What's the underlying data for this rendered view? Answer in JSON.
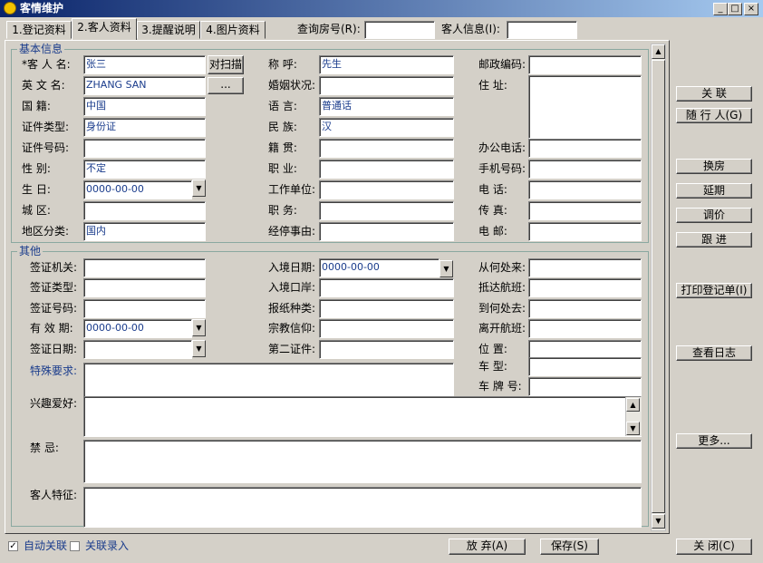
{
  "window": {
    "title": "客情维护",
    "min": "_",
    "max": "□",
    "close": "×"
  },
  "tabs": [
    "1.登记资料",
    "2.客人资料",
    "3.提醒说明",
    "4.图片资料"
  ],
  "search": {
    "room_label": "查询房号(R):",
    "guest_label": "客人信息(I):"
  },
  "basic": {
    "title": "基本信息",
    "rows": [
      {
        "l1": "*客 人 名:",
        "v1": "张三",
        "l2": "称    呼:",
        "v2": "先生",
        "l3": "邮政编码:",
        "v3": ""
      },
      {
        "l1": "英 文 名:",
        "v1": "ZHANG SAN",
        "l2": "婚姻状况:",
        "v2": "",
        "l3": "住    址:",
        "v3": ""
      },
      {
        "l1": "国    籍:",
        "v1": "中国",
        "l2": "语    言:",
        "v2": "普通话"
      },
      {
        "l1": "证件类型:",
        "v1": "身份证",
        "l2": "民    族:",
        "v2": "汉"
      },
      {
        "l1": "证件号码:",
        "v1": "",
        "l2": "籍    贯:",
        "v2": "",
        "l3": "办公电话:",
        "v3": ""
      },
      {
        "l1": "性    别:",
        "v1": "不定",
        "l2": "职    业:",
        "v2": "",
        "l3": "手机号码:",
        "v3": ""
      },
      {
        "l1": "生    日:",
        "v1": "0000-00-00",
        "l2": "工作单位:",
        "v2": "",
        "l3": "电    话:",
        "v3": ""
      },
      {
        "l1": "城    区:",
        "v1": "",
        "l2": "职    务:",
        "v2": "",
        "l3": "传    真:",
        "v3": ""
      },
      {
        "l1": "地区分类:",
        "v1": "国内",
        "l2": "经停事由:",
        "v2": "",
        "l3": "电    邮:",
        "v3": ""
      }
    ],
    "scan_btn": "对扫描",
    "ellipsis_btn": "..."
  },
  "other": {
    "title": "其他",
    "rows": [
      {
        "l1": "签证机关:",
        "v1": "",
        "l2": "入境日期:",
        "v2": "0000-00-00",
        "l3": "从何处来:",
        "v3": ""
      },
      {
        "l1": "签证类型:",
        "v1": "",
        "l2": "入境口岸:",
        "v2": "",
        "l3": "抵达航班:",
        "v3": ""
      },
      {
        "l1": "签证号码:",
        "v1": "",
        "l2": "报纸种类:",
        "v2": "",
        "l3": "到何处去:",
        "v3": ""
      },
      {
        "l1": "有 效 期:",
        "v1": "0000-00-00",
        "l2": "宗教信仰:",
        "v2": "",
        "l3": "离开航班:",
        "v3": ""
      },
      {
        "l1": "签证日期:",
        "v1": "",
        "l2": "第二证件:",
        "v2": "",
        "l3": "位    置:",
        "v3": ""
      }
    ],
    "car_type": "车    型:",
    "plate": "车 牌 号:",
    "special": "特殊要求:",
    "hobby": "兴趣爱好:",
    "taboo": "禁    忌:",
    "features": "客人特征:"
  },
  "side_buttons": [
    "关    联",
    "随 行 人(G)",
    "换房",
    "延期",
    "调价",
    "跟    进",
    "打印登记单(I)",
    "查看日志",
    "更多..."
  ],
  "bottom": {
    "auto_link": "自动关联",
    "link_entry": "关联录入",
    "discard": "放    弃(A)",
    "save": "保存(S)",
    "close": "关    闭(C)"
  },
  "colors": {
    "title_start": "#0a246a",
    "title_end": "#a6caf0",
    "face": "#d4d0c8",
    "value_text": "#1a3c8c"
  }
}
